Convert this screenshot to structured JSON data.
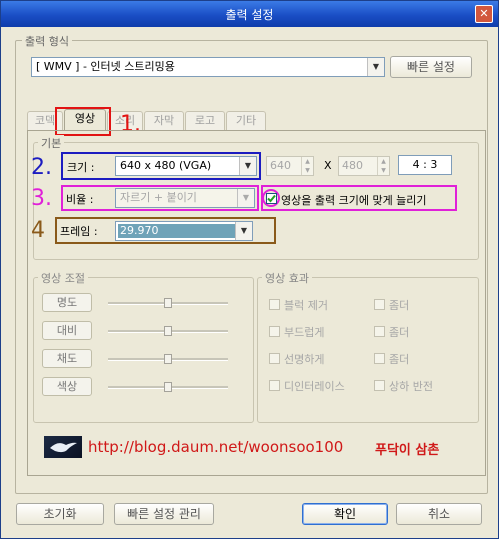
{
  "window": {
    "title": "출력 설정",
    "close": "✕"
  },
  "output_format": {
    "legend": "출력 형식",
    "value": "[ WMV ] - 인터넷 스트리밍용",
    "quick_settings": "빠른 설정"
  },
  "tabs": [
    {
      "label": "코덱"
    },
    {
      "label": "영상"
    },
    {
      "label": "소리"
    },
    {
      "label": "자막"
    },
    {
      "label": "로고"
    },
    {
      "label": "기타"
    }
  ],
  "basic": {
    "legend": "기본",
    "size_label": "크기 :",
    "size_value": "640 x 480 (VGA)",
    "width": "640",
    "x": "X",
    "height": "480",
    "aspect": "4 : 3",
    "ratio_label": "비율 :",
    "ratio_value": "자르기 + 붙이기",
    "stretch_label": "영상을 출력 크기에 맞게 늘리기",
    "frame_label": "프레임 :",
    "frame_value": "29.970"
  },
  "annotations": [
    "1.",
    "2.",
    "3.",
    "4"
  ],
  "adjust": {
    "legend": "영상 조절",
    "items": [
      "명도",
      "대비",
      "채도",
      "색상"
    ],
    "levels": [
      0.5,
      0.5,
      0.5,
      0.5
    ]
  },
  "effects": {
    "legend": "영상 효과",
    "items": [
      "블럭 제거",
      "부드럽게",
      "선명하게",
      "디인터레이스"
    ],
    "more": [
      "좀더",
      "좀더",
      "좀더",
      "상하 반전"
    ]
  },
  "banner": {
    "url": "http://blog.daum.net/woonsoo100",
    "name": "푸닥이 삼촌"
  },
  "buttons": {
    "reset": "초기화",
    "manage": "빠른 설정 관리",
    "ok": "확인",
    "cancel": "취소"
  },
  "colors": {
    "red": "#e21313",
    "blue": "#1c1cc0",
    "magenta": "#e020d8",
    "brown": "#8a5a1a"
  }
}
